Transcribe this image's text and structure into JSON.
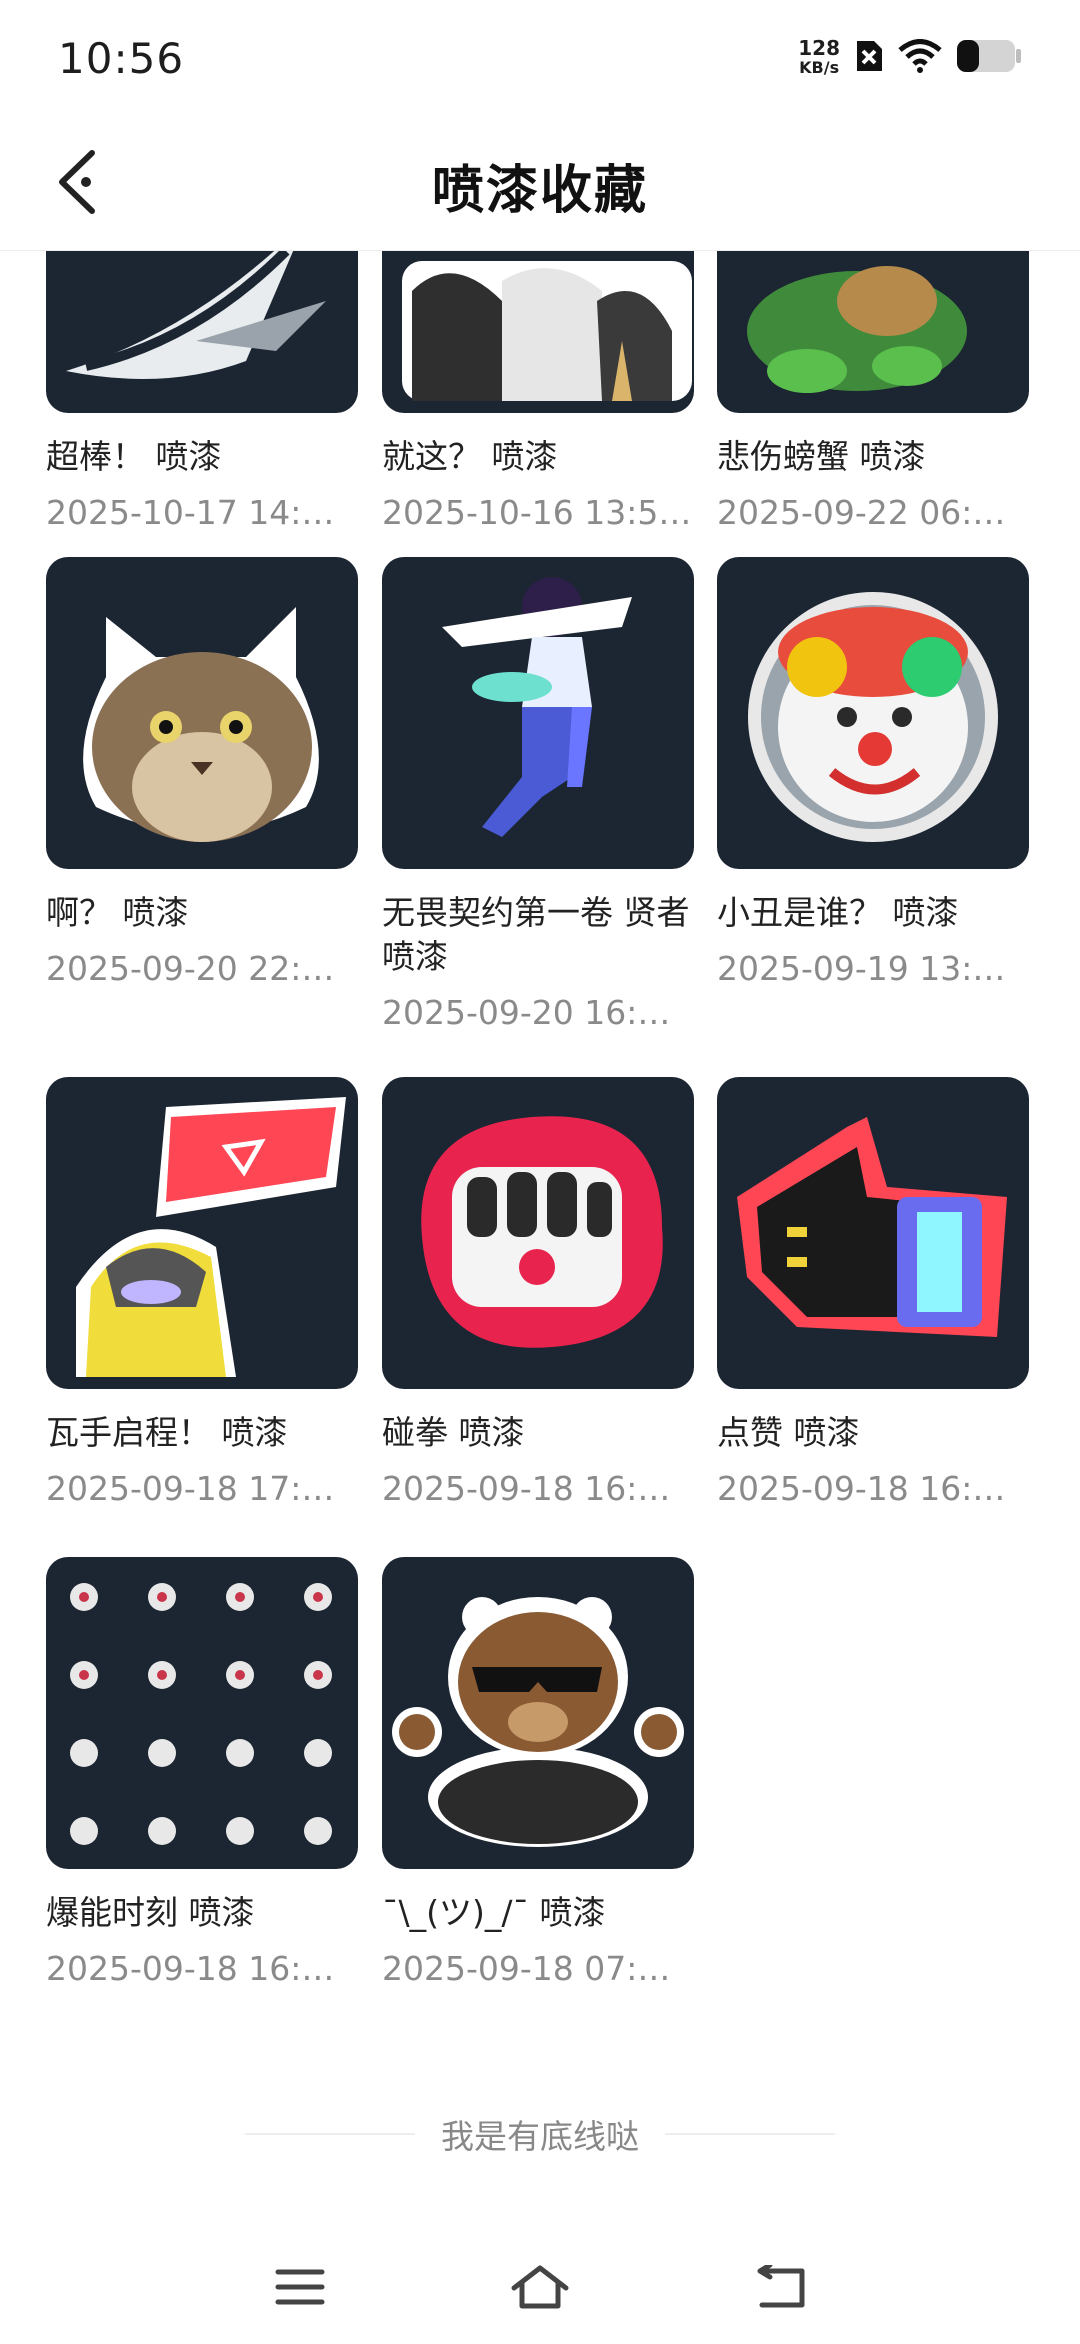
{
  "status_bar": {
    "time": "10:56",
    "net_speed_value": "128",
    "net_speed_unit": "KB/s",
    "icons": [
      "sim-disabled-icon",
      "wifi-icon",
      "battery-icon"
    ]
  },
  "header": {
    "title": "喷漆收藏",
    "back_icon": "back-chevron-icon"
  },
  "sprays": [
    {
      "title": "超棒！ 喷漆",
      "date": "2025-10-17 14:…"
    },
    {
      "title": "就这？ 喷漆",
      "date": "2025-10-16 13:5…"
    },
    {
      "title": "悲伤螃蟹 喷漆",
      "date": "2025-09-22 06:…"
    },
    {
      "title": "啊？ 喷漆",
      "date": "2025-09-20 22:…"
    },
    {
      "title": "无畏契约第一卷 贤者 喷漆",
      "date": "2025-09-20 16:…"
    },
    {
      "title": "小丑是谁？ 喷漆",
      "date": "2025-09-19 13:…"
    },
    {
      "title": "瓦手启程！ 喷漆",
      "date": "2025-09-18 17:…"
    },
    {
      "title": "碰拳 喷漆",
      "date": "2025-09-18 16:…"
    },
    {
      "title": "点赞 喷漆",
      "date": "2025-09-18 16:…"
    },
    {
      "title": "爆能时刻 喷漆",
      "date": "2025-09-18 16:…"
    },
    {
      "title": "¯\\_(ツ)_/¯ 喷漆",
      "date": "2025-09-18 07:…"
    }
  ],
  "footer": {
    "end_text": "我是有底线哒"
  },
  "nav_bar": {
    "icons": [
      "menu-icon",
      "home-icon",
      "back-icon"
    ]
  },
  "colors": {
    "thumb_bg": "#1c2633",
    "date_text": "#8a8a8a"
  }
}
